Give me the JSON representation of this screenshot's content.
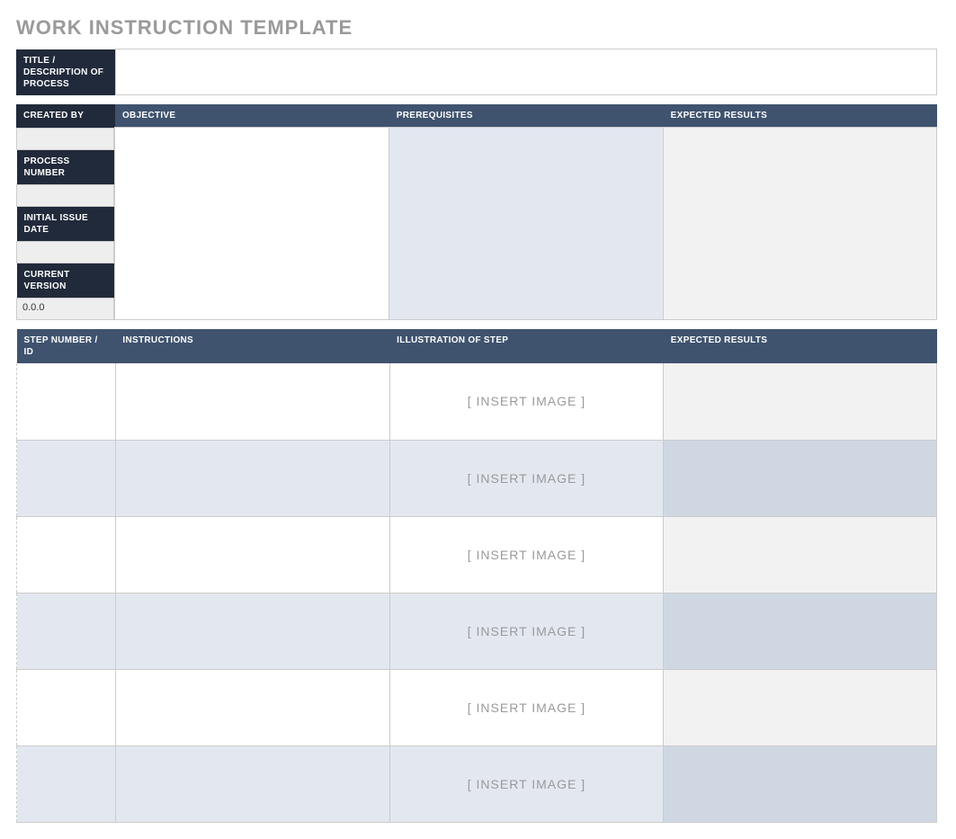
{
  "title": "WORK INSTRUCTION TEMPLATE",
  "title_desc": {
    "label": "TITLE / DESCRIPTION OF  PROCESS",
    "value": ""
  },
  "meta_labels": {
    "created_by": "CREATED BY",
    "process_number": "PROCESS NUMBER",
    "initial_issue_date": "INITIAL ISSUE DATE",
    "current_version": "CURRENT VERSION"
  },
  "meta_values": {
    "created_by": "",
    "process_number": "",
    "initial_issue_date": "",
    "current_version": "0.0.0"
  },
  "meta_cols": {
    "objective": "OBJECTIVE",
    "prerequisites": "PREREQUISITES",
    "expected_results": "EXPECTED RESULTS"
  },
  "meta_col_values": {
    "objective": "",
    "prerequisites": "",
    "expected_results": ""
  },
  "steps_header": {
    "step_id": "STEP NUMBER / ID",
    "instructions": "INSTRUCTIONS",
    "illustration": "ILLUSTRATION OF STEP",
    "expected": "EXPECTED RESULTS"
  },
  "insert_image_text": "[ INSERT IMAGE ]",
  "steps": [
    {
      "id": "",
      "instructions": "",
      "expected": ""
    },
    {
      "id": "",
      "instructions": "",
      "expected": ""
    },
    {
      "id": "",
      "instructions": "",
      "expected": ""
    },
    {
      "id": "",
      "instructions": "",
      "expected": ""
    },
    {
      "id": "",
      "instructions": "",
      "expected": ""
    },
    {
      "id": "",
      "instructions": "",
      "expected": ""
    }
  ]
}
